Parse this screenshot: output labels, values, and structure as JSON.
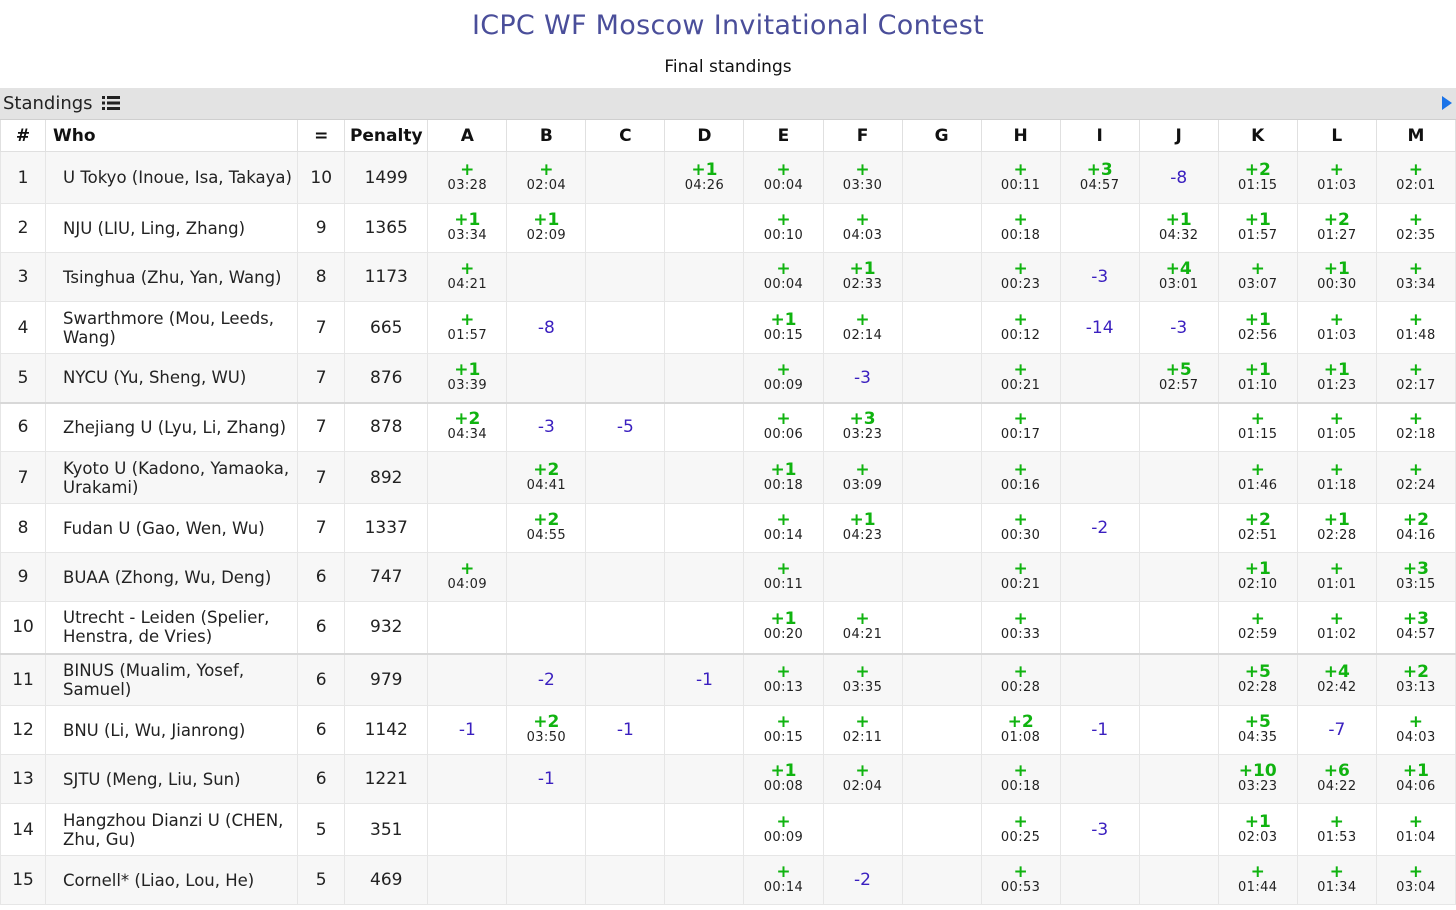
{
  "header": {
    "title": "ICPC WF Moscow Invitational Contest",
    "subtitle": "Final standings"
  },
  "standings_bar": {
    "label": "Standings"
  },
  "table": {
    "columns": {
      "rank": "#",
      "who": "Who",
      "solved": "=",
      "penalty": "Penalty",
      "problems": [
        "A",
        "B",
        "C",
        "D",
        "E",
        "F",
        "G",
        "H",
        "I",
        "J",
        "K",
        "L",
        "M"
      ]
    },
    "rows": [
      {
        "rank": "1",
        "who": "U Tokyo (Inoue, Isa, Takaya)",
        "solved": "10",
        "penalty": "1499",
        "cells": [
          [
            "+",
            "03:28"
          ],
          [
            "+",
            "02:04"
          ],
          null,
          [
            "+1",
            "04:26"
          ],
          [
            "+",
            "00:04"
          ],
          [
            "+",
            "03:30"
          ],
          null,
          [
            "+",
            "00:11"
          ],
          [
            "+3",
            "04:57"
          ],
          [
            "-8"
          ],
          [
            "+2",
            "01:15"
          ],
          [
            "+",
            "01:03"
          ],
          [
            "+",
            "02:01"
          ]
        ]
      },
      {
        "rank": "2",
        "who": "NJU (LIU, Ling, Zhang)",
        "solved": "9",
        "penalty": "1365",
        "cells": [
          [
            "+1",
            "03:34"
          ],
          [
            "+1",
            "02:09"
          ],
          null,
          null,
          [
            "+",
            "00:10"
          ],
          [
            "+",
            "04:03"
          ],
          null,
          [
            "+",
            "00:18"
          ],
          null,
          [
            "+1",
            "04:32"
          ],
          [
            "+1",
            "01:57"
          ],
          [
            "+2",
            "01:27"
          ],
          [
            "+",
            "02:35"
          ]
        ]
      },
      {
        "rank": "3",
        "who": "Tsinghua (Zhu, Yan, Wang)",
        "solved": "8",
        "penalty": "1173",
        "cells": [
          [
            "+",
            "04:21"
          ],
          null,
          null,
          null,
          [
            "+",
            "00:04"
          ],
          [
            "+1",
            "02:33"
          ],
          null,
          [
            "+",
            "00:23"
          ],
          [
            "-3"
          ],
          [
            "+4",
            "03:01"
          ],
          [
            "+",
            "03:07"
          ],
          [
            "+1",
            "00:30"
          ],
          [
            "+",
            "03:34"
          ]
        ]
      },
      {
        "rank": "4",
        "who": "Swarthmore (Mou, Leeds, Wang)",
        "solved": "7",
        "penalty": "665",
        "cells": [
          [
            "+",
            "01:57"
          ],
          [
            "-8"
          ],
          null,
          null,
          [
            "+1",
            "00:15"
          ],
          [
            "+",
            "02:14"
          ],
          null,
          [
            "+",
            "00:12"
          ],
          [
            "-14"
          ],
          [
            "-3"
          ],
          [
            "+1",
            "02:56"
          ],
          [
            "+",
            "01:03"
          ],
          [
            "+",
            "01:48"
          ]
        ]
      },
      {
        "rank": "5",
        "who": "NYCU (Yu, Sheng, WU)",
        "solved": "7",
        "penalty": "876",
        "cells": [
          [
            "+1",
            "03:39"
          ],
          null,
          null,
          null,
          [
            "+",
            "00:09"
          ],
          [
            "-3"
          ],
          null,
          [
            "+",
            "00:21"
          ],
          null,
          [
            "+5",
            "02:57"
          ],
          [
            "+1",
            "01:10"
          ],
          [
            "+1",
            "01:23"
          ],
          [
            "+",
            "02:17"
          ]
        ]
      },
      {
        "rank": "6",
        "who": "Zhejiang U (Lyu, Li, Zhang)",
        "solved": "7",
        "penalty": "878",
        "cells": [
          [
            "+2",
            "04:34"
          ],
          [
            "-3"
          ],
          [
            "-5"
          ],
          null,
          [
            "+",
            "00:06"
          ],
          [
            "+3",
            "03:23"
          ],
          null,
          [
            "+",
            "00:17"
          ],
          null,
          null,
          [
            "+",
            "01:15"
          ],
          [
            "+",
            "01:05"
          ],
          [
            "+",
            "02:18"
          ]
        ]
      },
      {
        "rank": "7",
        "who": "Kyoto U (Kadono, Yamaoka, Urakami)",
        "solved": "7",
        "penalty": "892",
        "cells": [
          null,
          [
            "+2",
            "04:41"
          ],
          null,
          null,
          [
            "+1",
            "00:18"
          ],
          [
            "+",
            "03:09"
          ],
          null,
          [
            "+",
            "00:16"
          ],
          null,
          null,
          [
            "+",
            "01:46"
          ],
          [
            "+",
            "01:18"
          ],
          [
            "+",
            "02:24"
          ]
        ]
      },
      {
        "rank": "8",
        "who": "Fudan U (Gao, Wen, Wu)",
        "solved": "7",
        "penalty": "1337",
        "cells": [
          null,
          [
            "+2",
            "04:55"
          ],
          null,
          null,
          [
            "+",
            "00:14"
          ],
          [
            "+1",
            "04:23"
          ],
          null,
          [
            "+",
            "00:30"
          ],
          [
            "-2"
          ],
          null,
          [
            "+2",
            "02:51"
          ],
          [
            "+1",
            "02:28"
          ],
          [
            "+2",
            "04:16"
          ]
        ]
      },
      {
        "rank": "9",
        "who": "BUAA (Zhong, Wu, Deng)",
        "solved": "6",
        "penalty": "747",
        "cells": [
          [
            "+",
            "04:09"
          ],
          null,
          null,
          null,
          [
            "+",
            "00:11"
          ],
          null,
          null,
          [
            "+",
            "00:21"
          ],
          null,
          null,
          [
            "+1",
            "02:10"
          ],
          [
            "+",
            "01:01"
          ],
          [
            "+3",
            "03:15"
          ]
        ]
      },
      {
        "rank": "10",
        "who": "Utrecht - Leiden (Spelier, Henstra, de Vries)",
        "solved": "6",
        "penalty": "932",
        "cells": [
          null,
          null,
          null,
          null,
          [
            "+1",
            "00:20"
          ],
          [
            "+",
            "04:21"
          ],
          null,
          [
            "+",
            "00:33"
          ],
          null,
          null,
          [
            "+",
            "02:59"
          ],
          [
            "+",
            "01:02"
          ],
          [
            "+3",
            "04:57"
          ]
        ]
      },
      {
        "rank": "11",
        "who": "BINUS (Mualim, Yosef, Samuel)",
        "solved": "6",
        "penalty": "979",
        "cells": [
          null,
          [
            "-2"
          ],
          null,
          [
            "-1"
          ],
          [
            "+",
            "00:13"
          ],
          [
            "+",
            "03:35"
          ],
          null,
          [
            "+",
            "00:28"
          ],
          null,
          null,
          [
            "+5",
            "02:28"
          ],
          [
            "+4",
            "02:42"
          ],
          [
            "+2",
            "03:13"
          ]
        ]
      },
      {
        "rank": "12",
        "who": "BNU (Li, Wu, Jianrong)",
        "solved": "6",
        "penalty": "1142",
        "cells": [
          [
            "-1"
          ],
          [
            "+2",
            "03:50"
          ],
          [
            "-1"
          ],
          null,
          [
            "+",
            "00:15"
          ],
          [
            "+",
            "02:11"
          ],
          null,
          [
            "+2",
            "01:08"
          ],
          [
            "-1"
          ],
          null,
          [
            "+5",
            "04:35"
          ],
          [
            "-7"
          ],
          [
            "+",
            "04:03"
          ]
        ]
      },
      {
        "rank": "13",
        "who": "SJTU (Meng, Liu, Sun)",
        "solved": "6",
        "penalty": "1221",
        "cells": [
          null,
          [
            "-1"
          ],
          null,
          null,
          [
            "+1",
            "00:08"
          ],
          [
            "+",
            "02:04"
          ],
          null,
          [
            "+",
            "00:18"
          ],
          null,
          null,
          [
            "+10",
            "03:23"
          ],
          [
            "+6",
            "04:22"
          ],
          [
            "+1",
            "04:06"
          ]
        ]
      },
      {
        "rank": "14",
        "who": "Hangzhou Dianzi U (CHEN, Zhu, Gu)",
        "solved": "5",
        "penalty": "351",
        "cells": [
          null,
          null,
          null,
          null,
          [
            "+",
            "00:09"
          ],
          null,
          null,
          [
            "+",
            "00:25"
          ],
          [
            "-3"
          ],
          null,
          [
            "+1",
            "02:03"
          ],
          [
            "+",
            "01:53"
          ],
          [
            "+",
            "01:04"
          ]
        ]
      },
      {
        "rank": "15",
        "who": "Cornell* (Liao, Lou, He)",
        "solved": "5",
        "penalty": "469",
        "cells": [
          null,
          null,
          null,
          null,
          [
            "+",
            "00:14"
          ],
          [
            "-2"
          ],
          null,
          [
            "+",
            "00:53"
          ],
          null,
          null,
          [
            "+",
            "01:44"
          ],
          [
            "+",
            "01:34"
          ],
          [
            "+",
            "03:04"
          ]
        ]
      }
    ]
  }
}
